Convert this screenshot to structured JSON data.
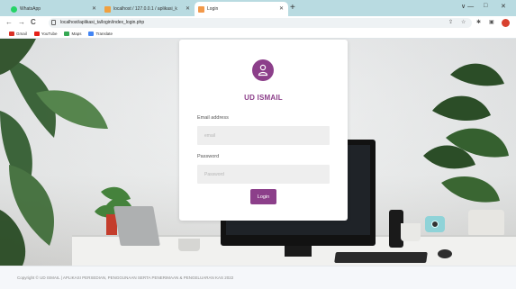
{
  "browser": {
    "tabs": [
      {
        "title": "WhatsApp",
        "favicon_color": "#25d366"
      },
      {
        "title": "localhost / 127.0.0.1 / aplikasi_k",
        "favicon_color": "#f0a040"
      },
      {
        "title": "Login",
        "favicon_color": "#f2994a",
        "active": true
      }
    ],
    "url": "localhost/aplikasi_ta/login/index_login.php",
    "bookmarks": [
      {
        "label": "Gmail",
        "icon": "gmail-icon",
        "color": "#d93025"
      },
      {
        "label": "YouTube",
        "icon": "youtube-icon",
        "color": "#e62117"
      },
      {
        "label": "Maps",
        "icon": "maps-icon",
        "color": "#34a853"
      },
      {
        "label": "Translate",
        "icon": "translate-icon",
        "color": "#4285f4"
      }
    ],
    "icons": {
      "back": "←",
      "forward": "→",
      "reload": "C",
      "new_tab": "+",
      "minimize": "∨  —",
      "maximize": "□",
      "close": "✕"
    }
  },
  "login": {
    "brand": "UD ISMAIL",
    "email_label": "Email address",
    "email_placeholder": "email",
    "password_label": "Password",
    "password_placeholder": "Password",
    "submit_label": "Login",
    "accent_color": "#8c3f8a"
  },
  "footer": {
    "text": "Copyright © UD ISMAIL | APLIKASI PERSEDIAN, PENGGUNAAN SERTA PENERIMAAN & PENGELUARAN KAS 2022"
  }
}
